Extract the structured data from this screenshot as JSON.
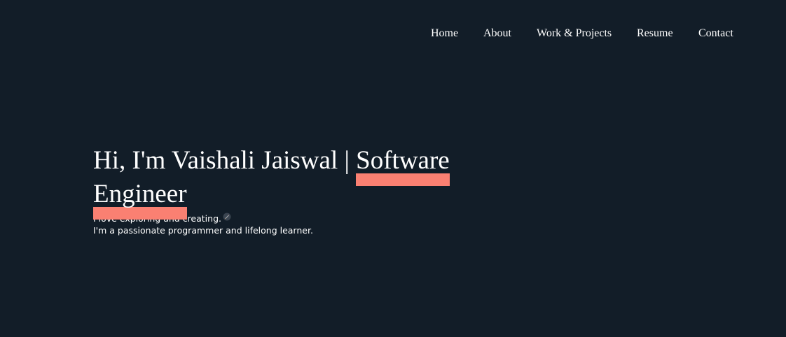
{
  "theme": {
    "background": "#121d28",
    "text": "#ffffff",
    "accent": "#fa8072"
  },
  "nav": {
    "items": [
      {
        "label": "Home"
      },
      {
        "label": "About"
      },
      {
        "label": "Work & Projects"
      },
      {
        "label": "Resume"
      },
      {
        "label": "Contact"
      }
    ]
  },
  "hero": {
    "title_prefix": "Hi, I'm Vaishali Jaiswal | ",
    "title_highlight_1": "Software",
    "title_highlight_2": "Engineer",
    "line1": "I love exploring and creating.",
    "line1_icon": "rocket-icon",
    "line2": "I'm a passionate programmer and lifelong learner."
  }
}
